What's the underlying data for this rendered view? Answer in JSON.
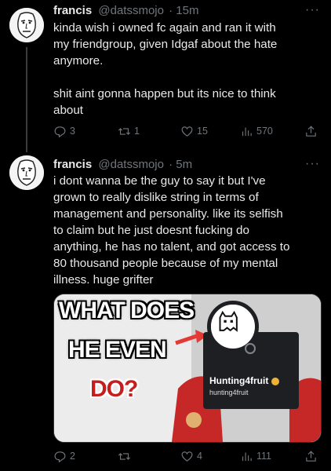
{
  "tweets": [
    {
      "name": "francis",
      "handle": "@datssmojo",
      "time": "· 15m",
      "text_lines": [
        "kinda wish i owned fc again  and ran it with",
        "my friendgroup, given Idgaf about the hate",
        "anymore.",
        "",
        "shit aint gonna happen but its nice to think",
        "about"
      ],
      "actions": {
        "replies": "3",
        "retweets": "1",
        "likes": "15",
        "views": "570"
      }
    },
    {
      "name": "francis",
      "handle": "@datssmojo",
      "time": "· 5m",
      "text_lines": [
        "i dont wanna be the guy to say it but I've",
        "grown to really dislike string in terms of",
        "management and personality. like its selfish",
        "to claim but he just doesnt fucking do",
        "anything, he has no talent, and got access to",
        "80 thousand people because of my mental",
        "illness. huge grifter"
      ],
      "media": {
        "line1": "WHAT DOES",
        "line2": "HE EVEN",
        "line3": "DO?",
        "profile_name": "Hunting4fruit",
        "profile_handle": "hunting4fruit"
      },
      "actions": {
        "replies": "2",
        "retweets": "",
        "likes": "4",
        "views": "111"
      }
    }
  ],
  "more_glyph": "···",
  "colors": {
    "background": "#000000",
    "text": "#e7e9ea",
    "muted": "#71767b",
    "thread_line": "#3a3d40"
  }
}
